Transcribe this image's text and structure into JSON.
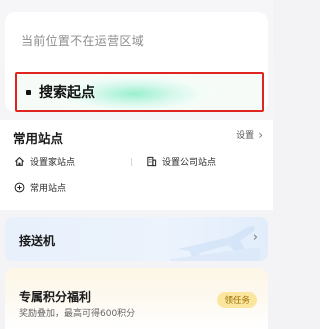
{
  "location": {
    "status_text": "当前位置不在运营区域",
    "search_start_label": "搜索起点"
  },
  "common_stations": {
    "title": "常用站点",
    "settings_label": "设置",
    "items": [
      {
        "label": "设置家站点",
        "icon": "home-icon"
      },
      {
        "label": "设置公司站点",
        "icon": "building-icon"
      },
      {
        "label": "常用站点",
        "icon": "add-circle-icon"
      }
    ]
  },
  "shuttle": {
    "title": "接送机",
    "icon": "airplane-icon"
  },
  "points": {
    "title": "专属积分福利",
    "description": "奖励叠加，最高可得600积分",
    "task_button_label": "领任务"
  },
  "colors": {
    "highlight_border": "#e0241f",
    "task_button_bg": "#fbe6a0",
    "task_button_text": "#9a6b00"
  }
}
